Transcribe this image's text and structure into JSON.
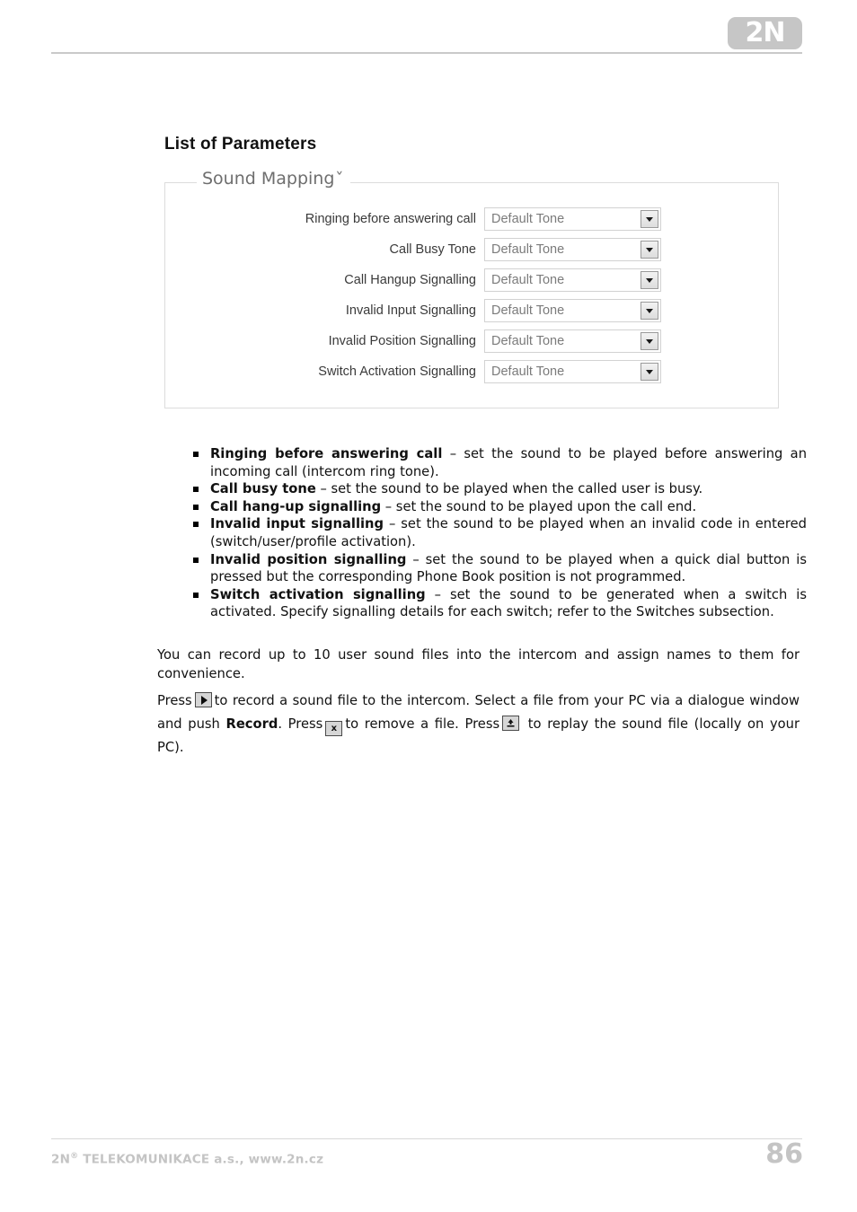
{
  "header": {
    "logo_text": "2N"
  },
  "main": {
    "page_title": "List of Parameters"
  },
  "panel": {
    "legend": "Sound Mapping",
    "chevron": "˅",
    "rows": [
      {
        "label": "Ringing before answering call",
        "value": "Default Tone"
      },
      {
        "label": "Call Busy Tone",
        "value": "Default Tone"
      },
      {
        "label": "Call Hangup Signalling",
        "value": "Default Tone"
      },
      {
        "label": "Invalid Input Signalling",
        "value": "Default Tone"
      },
      {
        "label": "Invalid Position Signalling",
        "value": "Default Tone"
      },
      {
        "label": "Switch Activation Signalling",
        "value": "Default Tone"
      }
    ]
  },
  "parameters": [
    {
      "term": "Ringing before answering call",
      "description": " – set the sound to be played before answering an incoming call (intercom ring tone)."
    },
    {
      "term": "Call busy tone",
      "description": " – set the sound to be played when the called user is busy."
    },
    {
      "term": "Call hang-up signalling",
      "description": " – set the sound to be played upon the call end."
    },
    {
      "term": "Invalid input signalling",
      "description": " – set the sound to be played when an invalid code in entered (switch/user/profile activation)."
    },
    {
      "term": "Invalid position signalling",
      "description": " – set the sound to be played when a quick dial button is pressed but the corresponding Phone Book position is not programmed."
    },
    {
      "term": "Switch activation signalling",
      "description": " – set the sound to be generated when a switch is activated. Specify signalling details for each switch; refer to the Switches subsection."
    }
  ],
  "body": {
    "record_info": "You can record up to 10 user sound files into the intercom and assign names to them for convenience.",
    "press_part1": "Press",
    "press_part2": "to record a sound file to the intercom. Select a file from your PC via a dialogue window and push",
    "record_bold": "Record",
    "press_part3": ". Press",
    "press_part4": "to remove a file. Press",
    "press_part5": "to replay the sound file (locally on your PC).",
    "icon_play": "play-icon",
    "icon_remove": "x",
    "icon_replay": "replay-icon"
  },
  "footer": {
    "company": "2N",
    "registered": "®",
    "company_rest": " TELEKOMUNIKACE a.s., www.2n.cz",
    "page_number": "86"
  }
}
